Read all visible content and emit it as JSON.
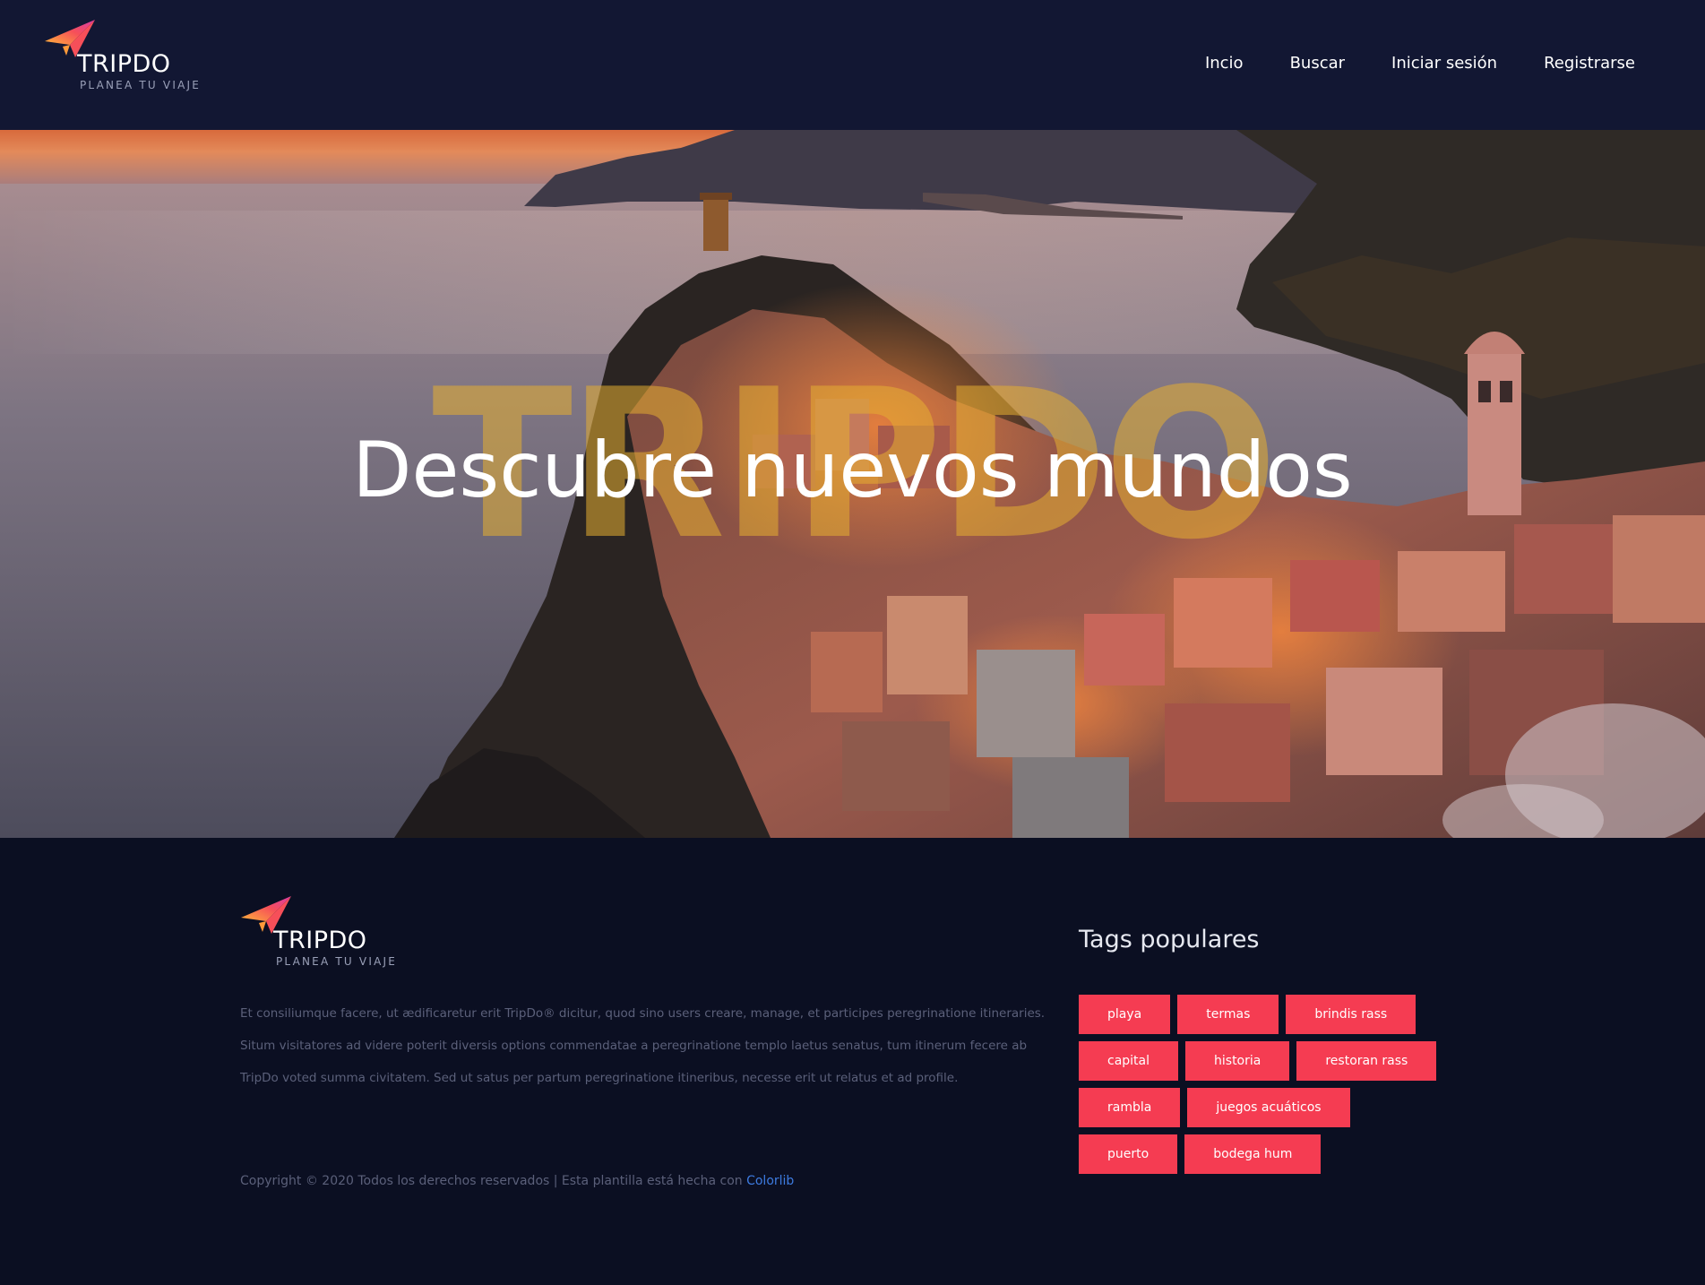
{
  "brand": {
    "name": "TRIPDO",
    "tagline": "PLANEA TU VIAJE"
  },
  "nav": {
    "items": [
      {
        "label": "Incio"
      },
      {
        "label": "Buscar"
      },
      {
        "label": "Iniciar sesión"
      },
      {
        "label": "Registrarse"
      }
    ]
  },
  "hero": {
    "watermark": "TRIPDO",
    "title": "Descubre nuevos mundos"
  },
  "footer": {
    "description": "Et consiliumque facere, ut ædificaretur erit TripDo® dicitur, quod sino users creare, manage, et participes peregrinatione itineraries. Situm visitatores ad videre poterit diversis options commendatae a peregrinatione templo laetus senatus, tum itinerum fecere ab TripDo voted summa civitatem. Sed ut satus per partum peregrinatione itineribus, necesse erit ut relatus et ad profile.",
    "copyright_text": "Copyright © 2020 Todos los derechos reservados | Esta plantilla está hecha con ",
    "copyright_link": "Colorlib",
    "tags_title": "Tags populares",
    "tag_rows": [
      [
        "playa",
        "termas",
        "brindis rass"
      ],
      [
        "capital",
        "historia",
        "restoran rass"
      ],
      [
        "rambla",
        "juegos acuáticos"
      ],
      [
        "puerto",
        "bodega hum"
      ]
    ]
  },
  "colors": {
    "header_bg": "#121733",
    "footer_bg": "#0b0f22",
    "tag_bg": "#f53c52",
    "link_blue": "#3d7be0",
    "watermark": "#e6af32"
  }
}
